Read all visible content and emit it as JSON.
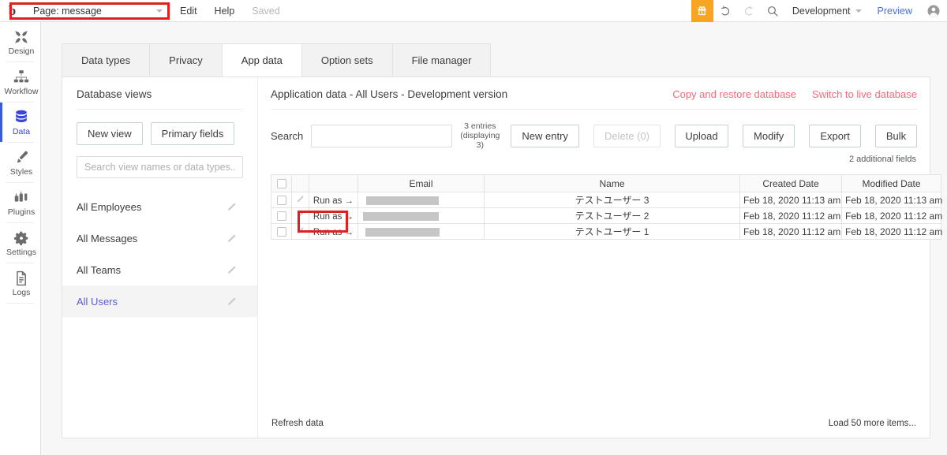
{
  "topbar": {
    "logo": "b",
    "page_selector": {
      "label": "Page: message",
      "icon": "chevron-down-icon"
    },
    "menu": [
      {
        "label": "Edit",
        "muted": false
      },
      {
        "label": "Help",
        "muted": false
      },
      {
        "label": "Saved",
        "muted": true
      }
    ],
    "gift_icon": "gift-icon",
    "undo_icon": "undo-icon",
    "redo_icon": "redo-icon",
    "search_icon": "search-icon",
    "environment": "Development",
    "environment_caret": "chevron-down-icon",
    "preview_label": "Preview",
    "avatar_icon": "user-avatar-icon",
    "accent_gift_bg": "#F6A623",
    "link_blue": "#4a6ee0"
  },
  "rail": {
    "active": "Data",
    "active_color": "#3b44dd",
    "items": [
      {
        "label": "Design",
        "icon": "design-icon"
      },
      {
        "label": "Workflow",
        "icon": "workflow-icon"
      },
      {
        "label": "Data",
        "icon": "database-icon"
      },
      {
        "label": "Styles",
        "icon": "brush-icon"
      },
      {
        "label": "Plugins",
        "icon": "plugins-icon"
      },
      {
        "label": "Settings",
        "icon": "gear-icon"
      },
      {
        "label": "Logs",
        "icon": "document-icon"
      }
    ]
  },
  "tabs": [
    {
      "label": "Data types",
      "active": false
    },
    {
      "label": "Privacy",
      "active": false
    },
    {
      "label": "App data",
      "active": true
    },
    {
      "label": "Option sets",
      "active": false
    },
    {
      "label": "File manager",
      "active": false
    }
  ],
  "views": {
    "title": "Database views",
    "new_view_label": "New view",
    "primary_fields_label": "Primary fields",
    "search_placeholder": "Search view names or data types...",
    "search_value": "",
    "items": [
      {
        "label": "All Employees",
        "selected": false
      },
      {
        "label": "All Messages",
        "selected": false
      },
      {
        "label": "All Teams",
        "selected": false
      },
      {
        "label": "All Users",
        "selected": true
      }
    ],
    "edit_icon": "pencil-icon",
    "selected_color": "#5b5bdc"
  },
  "data": {
    "title": "Application data - All Users - Development version",
    "links": [
      {
        "label": "Copy and restore database"
      },
      {
        "label": "Switch to live database"
      }
    ],
    "link_color": "#f5697c",
    "search_label": "Search",
    "search_value": "",
    "entries_line1": "3 entries",
    "entries_line2": "(displaying 3)",
    "buttons": [
      {
        "label": "New entry",
        "disabled": false
      },
      {
        "label": "Delete (0)",
        "disabled": true
      },
      {
        "label": "Upload",
        "disabled": false
      },
      {
        "label": "Modify",
        "disabled": false
      },
      {
        "label": "Export",
        "disabled": false
      },
      {
        "label": "Bulk",
        "disabled": false
      }
    ],
    "additional_fields": "2 additional fields",
    "columns": [
      "",
      "",
      "",
      "Email",
      "Name",
      "Created Date",
      "Modified Date"
    ],
    "run_as_label": "Run as →",
    "rows": [
      {
        "checked": false,
        "email_redacted": true,
        "email": "",
        "name": "テストユーザー 3",
        "created": "Feb 18, 2020 11:13 am",
        "modified": "Feb 18, 2020 11:13 am"
      },
      {
        "checked": false,
        "email_redacted": true,
        "email": "",
        "name": "テストユーザー 2",
        "created": "Feb 18, 2020 11:12 am",
        "modified": "Feb 18, 2020 11:12 am"
      },
      {
        "checked": false,
        "email_redacted": true,
        "email": "",
        "name": "テストユーザー 1",
        "created": "Feb 18, 2020 11:12 am",
        "modified": "Feb 18, 2020 11:12 am"
      }
    ],
    "refresh_label": "Refresh data",
    "load_more_label": "Load 50 more items..."
  },
  "annotations": {
    "color": "#e02020",
    "boxes": [
      {
        "target": "page-selector"
      },
      {
        "target": "run-as-row-1"
      }
    ]
  }
}
